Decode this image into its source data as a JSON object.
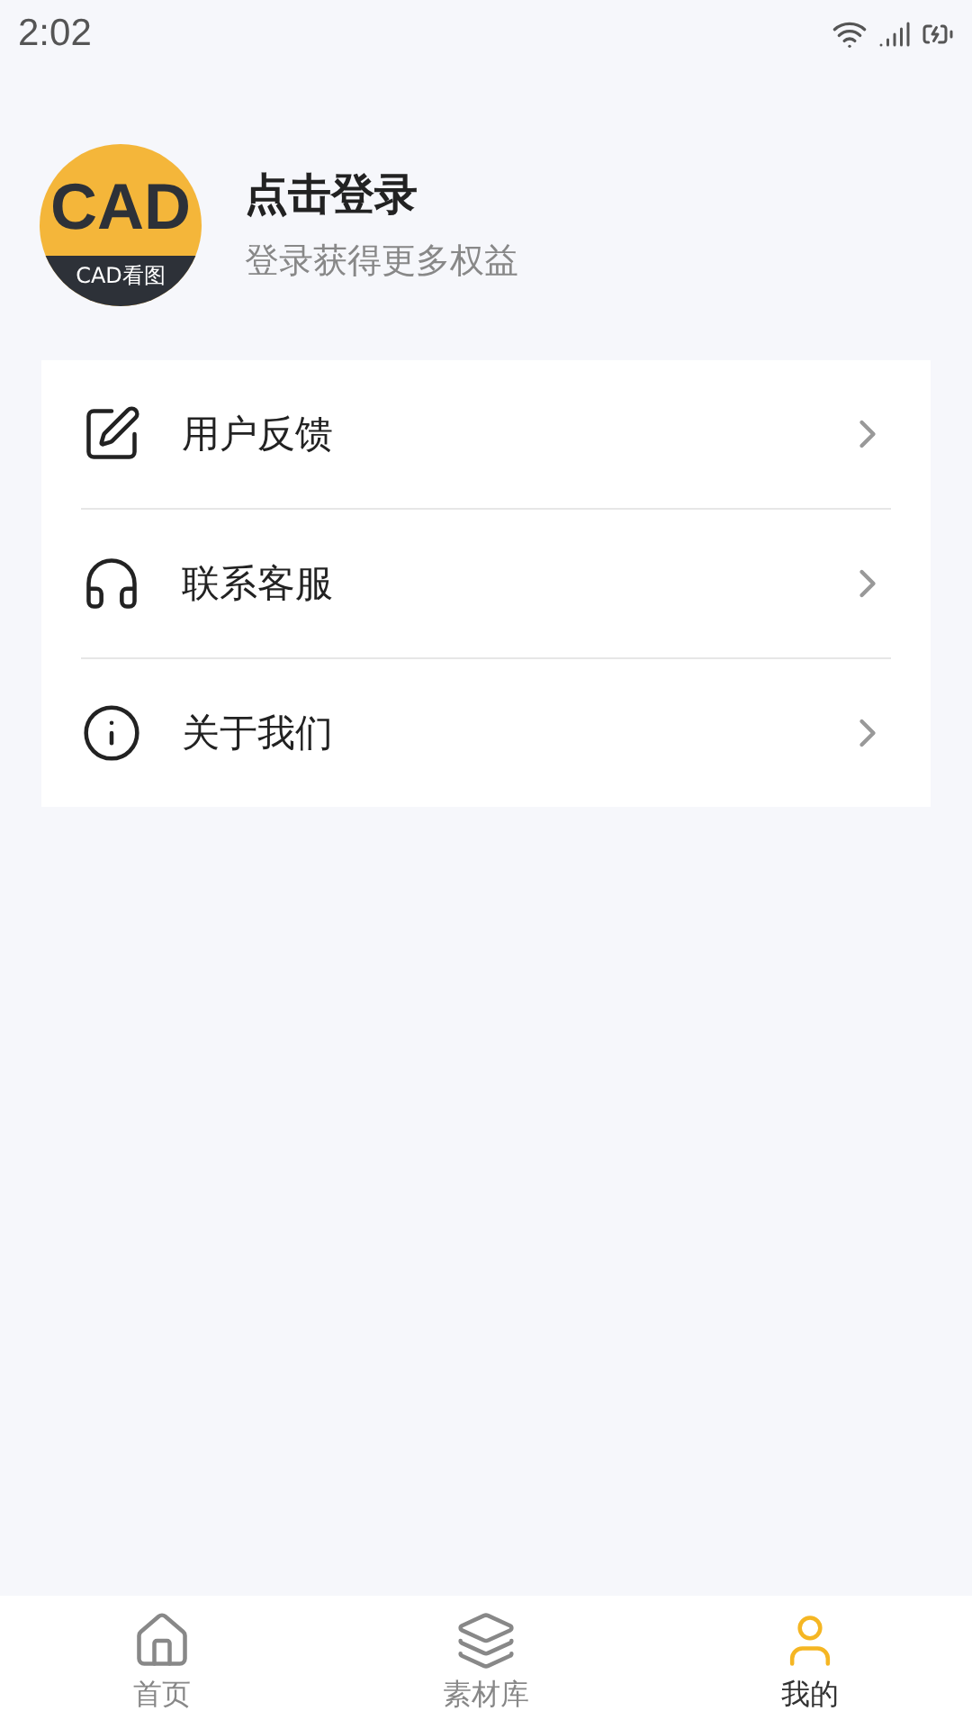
{
  "status_bar": {
    "time": "2:02"
  },
  "profile": {
    "logo_text": "CAD",
    "logo_caption": "CAD看图",
    "title": "点击登录",
    "subtitle": "登录获得更多权益"
  },
  "menu": [
    {
      "kind": "feedback",
      "label": "用户反馈"
    },
    {
      "kind": "service",
      "label": "联系客服"
    },
    {
      "kind": "about",
      "label": "关于我们"
    }
  ],
  "tabs": [
    {
      "kind": "home",
      "label": "首页",
      "selected": false
    },
    {
      "kind": "library",
      "label": "素材库",
      "selected": false
    },
    {
      "kind": "mine",
      "label": "我的",
      "selected": true
    }
  ]
}
